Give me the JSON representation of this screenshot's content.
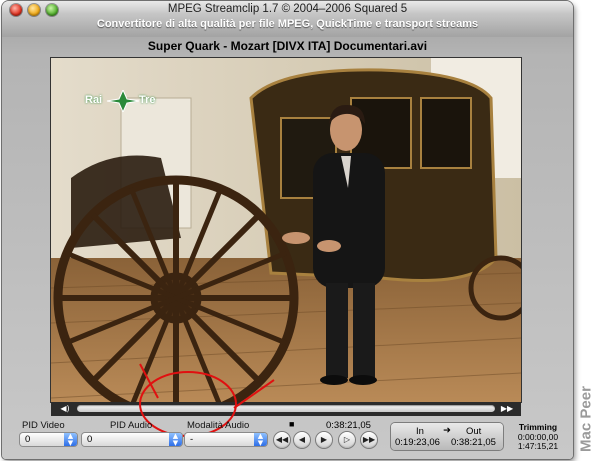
{
  "window": {
    "title": "MPEG Streamclip 1.7  ©  2004–2006 Squared 5",
    "subtitle": "Convertitore di alta qualità per file MPEG, QuickTime e transport streams",
    "file_name": "Super Quark - Mozart [DIVX ITA] Documentari.avi"
  },
  "video": {
    "channel_logo_left": "Rai",
    "channel_logo_right": "Tre"
  },
  "scrubber": {
    "left_button": "◀)",
    "right_button": "▶▶",
    "position_fraction": 0.0
  },
  "controls": {
    "pid_video_label": "PID Video",
    "pid_video_value": "0",
    "pid_audio_label": "PID Audio",
    "pid_audio_value": "0",
    "audio_mode_label": "Modalità Audio",
    "audio_mode_value": "-",
    "stop_symbol": "■",
    "current_time": "0:38:21,05",
    "in_label": "In",
    "out_label": "Out",
    "arrow": "➜",
    "in_time": "0:19:23,06",
    "out_time": "0:38:21,05",
    "trimming_label": "Trimming",
    "trimming_start": "0:00:00,00",
    "trimming_end": "1:47:15,21"
  },
  "transport": {
    "rewind": "◀◀",
    "step_back": "◀",
    "play": "▶",
    "step_forward": "▷",
    "fast_forward": "▶▶"
  },
  "watermark": "Mac Peer",
  "annotation_color": "#e01010"
}
